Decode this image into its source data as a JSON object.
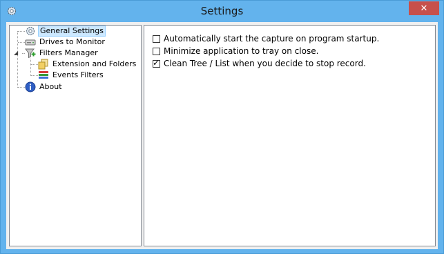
{
  "window": {
    "title": "Settings",
    "close_glyph": "✕",
    "app_icon": "gear-icon",
    "colors": {
      "titlebar": "#63b3ed",
      "close": "#c7504b",
      "selection": "#cce8ff"
    }
  },
  "tree": {
    "items": [
      {
        "label": "General Settings",
        "icon": "gear-icon",
        "selected": true
      },
      {
        "label": "Drives to Monitor",
        "icon": "drive-icon"
      },
      {
        "label": "Filters Manager",
        "icon": "filter-icon",
        "expanded": true
      },
      {
        "label": "Extension and Folders",
        "icon": "folder-icon"
      },
      {
        "label": "Events Filters",
        "icon": "events-icon"
      },
      {
        "label": "About",
        "icon": "info-icon"
      }
    ],
    "expander_glyph": "◢"
  },
  "options": [
    {
      "label": "Automatically start the capture on program startup.",
      "checked": false
    },
    {
      "label": "Minimize application to tray on close.",
      "checked": false
    },
    {
      "label": "Clean Tree / List when you decide to stop record.",
      "checked": true
    }
  ],
  "check_glyph": "✓"
}
